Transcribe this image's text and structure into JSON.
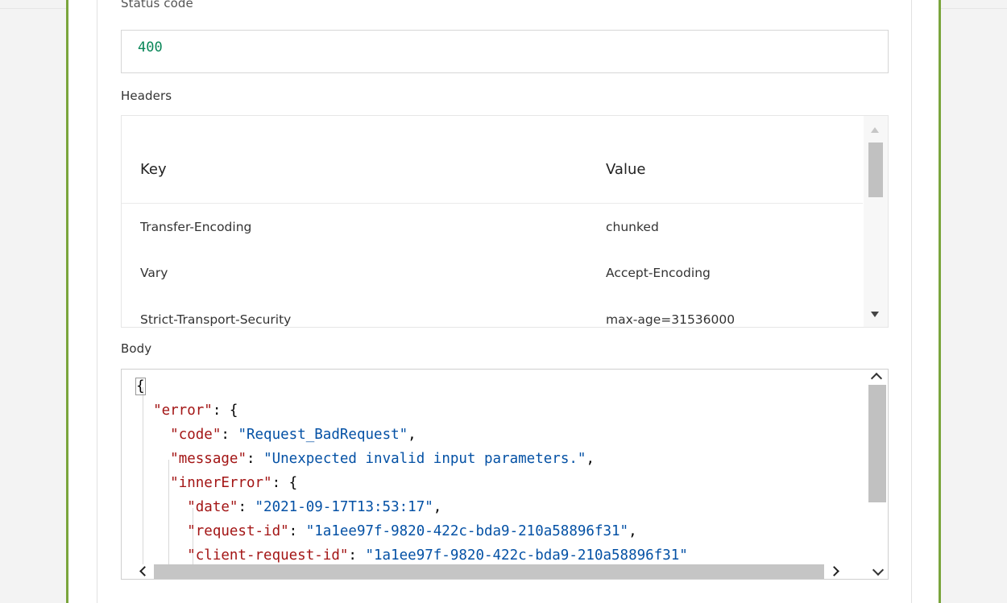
{
  "status": {
    "label": "Status code",
    "value": "400"
  },
  "headers": {
    "label": "Headers",
    "columns": {
      "key": "Key",
      "value": "Value"
    },
    "rows": [
      {
        "key": "Transfer-Encoding",
        "value": "chunked"
      },
      {
        "key": "Vary",
        "value": "Accept-Encoding"
      },
      {
        "key": "Strict-Transport-Security",
        "value": "max-age=31536000"
      }
    ]
  },
  "body": {
    "label": "Body",
    "lines": {
      "l0": "{",
      "l1k": "\"error\"",
      "l1p": ": {",
      "l2k": "\"code\"",
      "l2v": "\"Request_BadRequest\"",
      "l3k": "\"message\"",
      "l3v": "\"Unexpected invalid input parameters.\"",
      "l4k": "\"innerError\"",
      "l4p": ": {",
      "l5k": "\"date\"",
      "l5v": "\"2021-09-17T13:53:17\"",
      "l6k": "\"request-id\"",
      "l6v": "\"1a1ee97f-9820-422c-bda9-210a58896f31\"",
      "l7k": "\"client-request-id\"",
      "l7v": "\"1a1ee97f-9820-422c-bda9-210a58896f31\""
    }
  },
  "colors": {
    "accent_border": "#7aa53c",
    "json_key": "#a31515",
    "json_string": "#0451a5",
    "status_number": "#098658"
  }
}
